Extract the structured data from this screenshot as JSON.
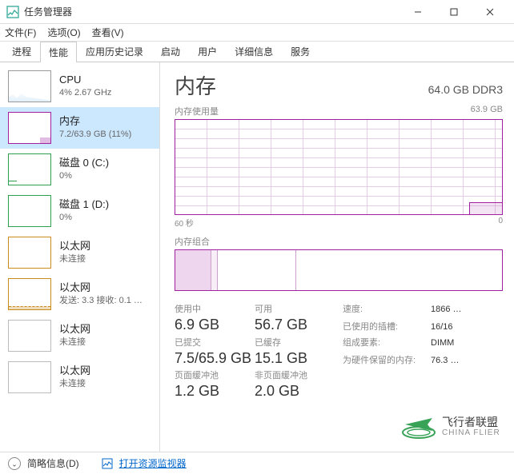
{
  "window": {
    "title": "任务管理器",
    "controls": {
      "min": "minimize",
      "max": "maximize",
      "close": "close"
    }
  },
  "menu": {
    "file": "文件(F)",
    "options": "选项(O)",
    "view": "查看(V)"
  },
  "tabs": {
    "items": [
      "进程",
      "性能",
      "应用历史记录",
      "启动",
      "用户",
      "详细信息",
      "服务"
    ],
    "active_index": 1
  },
  "sidebar": [
    {
      "label": "CPU",
      "sub": "4% 2.67 GHz",
      "kind": "cpu"
    },
    {
      "label": "内存",
      "sub": "7.2/63.9 GB (11%)",
      "kind": "mem",
      "selected": true
    },
    {
      "label": "磁盘 0 (C:)",
      "sub": "0%",
      "kind": "disk0"
    },
    {
      "label": "磁盘 1 (D:)",
      "sub": "0%",
      "kind": "disk1"
    },
    {
      "label": "以太网",
      "sub": "未连接",
      "kind": "net0"
    },
    {
      "label": "以太网",
      "sub": "发送: 3.3 接收: 0.1 …",
      "kind": "net1"
    },
    {
      "label": "以太网",
      "sub": "未连接",
      "kind": "net2"
    },
    {
      "label": "以太网",
      "sub": "未连接",
      "kind": "net3"
    }
  ],
  "detail": {
    "title": "内存",
    "total": "64.0 GB DDR3",
    "usage_label": "内存使用量",
    "usage_max": "63.9 GB",
    "axis_left": "60 秒",
    "axis_right": "0",
    "composition_label": "内存组合",
    "stats": {
      "in_use_lbl": "使用中",
      "in_use": "6.9 GB",
      "avail_lbl": "可用",
      "avail": "56.7 GB",
      "committed_lbl": "已提交",
      "committed": "7.5/65.9 GB",
      "cached_lbl": "已缓存",
      "cached": "15.1 GB",
      "paged_lbl": "页面缓冲池",
      "paged": "1.2 GB",
      "nonpaged_lbl": "非页面缓冲池",
      "nonpaged": "2.0 GB"
    },
    "meta": {
      "speed_lbl": "速度:",
      "speed": "1866 …",
      "slots_lbl": "已使用的插槽:",
      "slots": "16/16",
      "form_lbl": "组成要素:",
      "form": "DIMM",
      "reserved_lbl": "为硬件保留的内存:",
      "reserved": "76.3 …"
    }
  },
  "bottom": {
    "fewer": "简略信息(D)",
    "resmon": "打开资源监视器"
  },
  "watermark": {
    "cn": "飞行者联盟",
    "en": "CHINA FLIER"
  },
  "chart_data": {
    "type": "line",
    "title": "内存使用量",
    "xlabel": "60 秒 → 0",
    "ylabel": "GB",
    "ylim": [
      0,
      63.9
    ],
    "x_seconds": [
      60,
      55,
      50,
      45,
      40,
      35,
      30,
      25,
      20,
      15,
      10,
      5,
      0
    ],
    "series": [
      {
        "name": "使用中 (GB)",
        "values": [
          7.2,
          7.2,
          7.2,
          7.2,
          7.2,
          7.2,
          7.2,
          7.2,
          7.2,
          7.2,
          7.2,
          7.2,
          7.2
        ]
      }
    ],
    "composition_gb": {
      "in_use": 6.9,
      "modified": 1.3,
      "standby": 15.1,
      "free": 40.6
    }
  }
}
